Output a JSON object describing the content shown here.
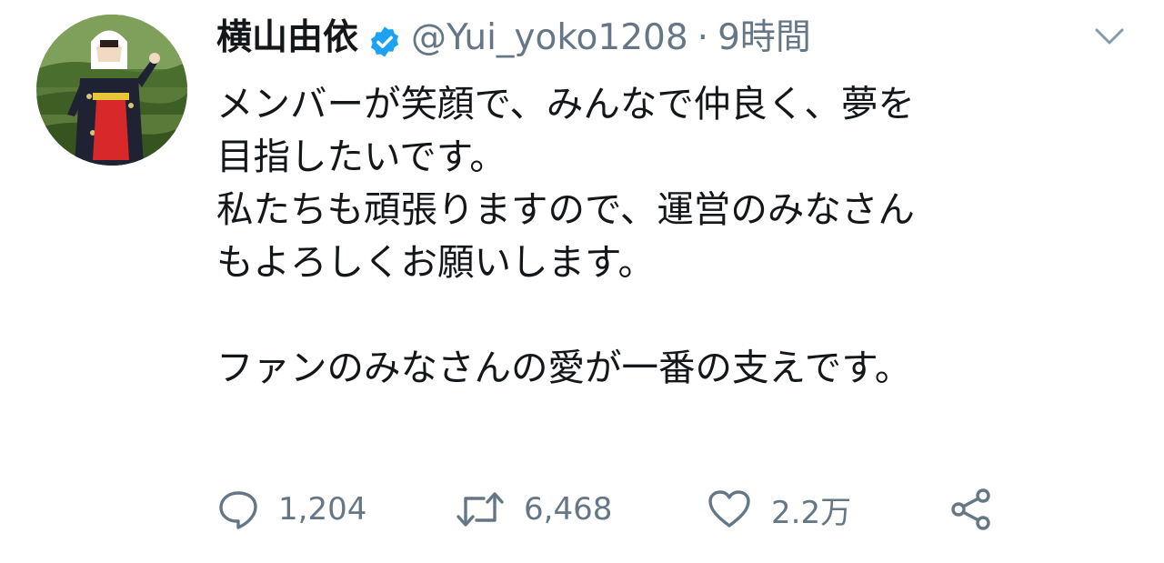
{
  "tweet": {
    "display_name": "横山由依",
    "handle": "@Yui_yoko1208",
    "separator": "·",
    "time": "9時間",
    "text_lines": [
      "メンバーが笑顔で、みんなで仲良く、夢を",
      "目指したいです。",
      "私たちも頑張りますので、運営のみなさん",
      "もよろしくお願いします。",
      "",
      "ファンのみなさんの愛が一番の支えです。"
    ]
  },
  "actions": {
    "reply_count": "1,204",
    "retweet_count": "6,468",
    "like_count": "2.2万"
  },
  "icons": {
    "verified": "verified-badge-icon",
    "caret": "chevron-down-icon",
    "reply": "reply-icon",
    "retweet": "retweet-icon",
    "like": "heart-icon",
    "share": "share-icon"
  },
  "colors": {
    "text": "#14171a",
    "secondary": "#657786",
    "verified": "#1da1f2"
  }
}
